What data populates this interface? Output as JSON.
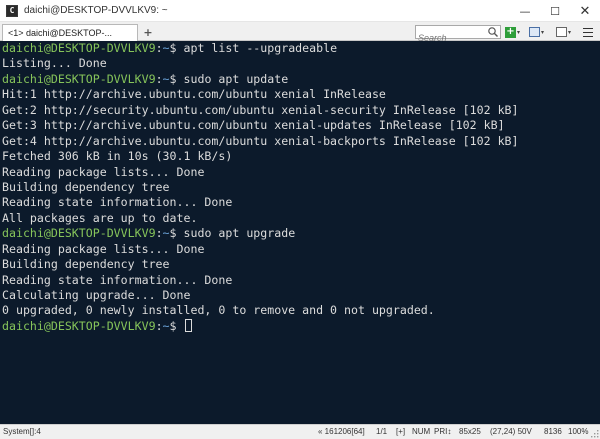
{
  "window": {
    "app_icon_glyph": "C",
    "title": "daichi@DESKTOP-DVVLKV9: ~",
    "minimize": "—",
    "maximize": "☐",
    "close": "✕"
  },
  "tabs": {
    "items": [
      {
        "label": "<1>  daichi@DESKTOP-..."
      }
    ],
    "add_label": "+"
  },
  "search": {
    "placeholder": "Search"
  },
  "toolbar": {
    "new_glyph": "+",
    "dropdown_glyph": "▾"
  },
  "terminal": {
    "user_host": "daichi@DESKTOP-DVVLKV9",
    "path": "~",
    "prompt_symbol": "$",
    "commands": [
      "apt list --upgradeable",
      "sudo apt update",
      "sudo apt upgrade"
    ],
    "output_blocks": [
      [
        "Listing... Done"
      ],
      [
        "Hit:1 http://archive.ubuntu.com/ubuntu xenial InRelease",
        "Get:2 http://security.ubuntu.com/ubuntu xenial-security InRelease [102 kB]",
        "Get:3 http://archive.ubuntu.com/ubuntu xenial-updates InRelease [102 kB]",
        "Get:4 http://archive.ubuntu.com/ubuntu xenial-backports InRelease [102 kB]",
        "Fetched 306 kB in 10s (30.1 kB/s)",
        "Reading package lists... Done",
        "Building dependency tree",
        "Reading state information... Done",
        "All packages are up to date."
      ],
      [
        "Reading package lists... Done",
        "Building dependency tree",
        "Reading state information... Done",
        "Calculating upgrade... Done",
        "0 upgraded, 0 newly installed, 0 to remove and 0 not upgraded."
      ]
    ]
  },
  "status": {
    "left": "System[]:4",
    "position": "« 161206[64]",
    "page": "1/1",
    "ins": "[+]",
    "num": "NUM",
    "pri": "PRI↕",
    "size": "85x25",
    "cursor_pos": "(27,24) 50V",
    "pid": "8136",
    "zoom": "100%"
  },
  "colors": {
    "terminal_bg": "#0c1a2b",
    "prompt_user": "#86c45a",
    "prompt_path": "#6aa3d9",
    "text": "#dcdcdc"
  }
}
